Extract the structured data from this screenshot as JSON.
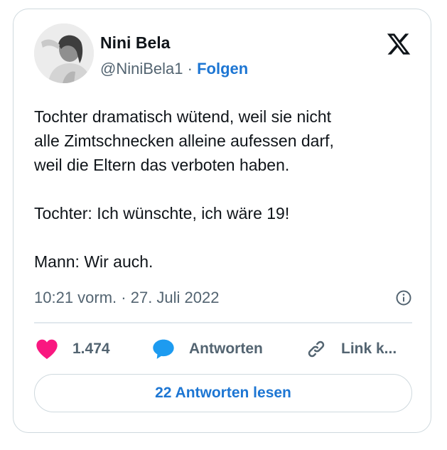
{
  "author": {
    "name": "Nini Bela",
    "handle": "@NiniBela1",
    "separator": "·",
    "follow_label": "Folgen",
    "avatar_icon": "profile-photo"
  },
  "brand_icon": "x-logo-icon",
  "tweet": {
    "lines": [
      "Tochter dramatisch wütend, weil sie nicht",
      "alle Zimtschnecken alleine aufessen darf,",
      "weil die Eltern das verboten haben.",
      "Tochter: Ich wünschte, ich wäre 19!",
      "Mann: Wir auch."
    ],
    "timestamp": "10:21 vorm. · 27. Juli 2022"
  },
  "actions": {
    "like_count": "1.474",
    "reply_label": "Antworten",
    "link_label": "Link k..."
  },
  "read_replies_label": "22 Antworten lesen",
  "colors": {
    "accent": "#1d76d3",
    "like": "#f91880",
    "reply": "#1d9bf0",
    "muted": "#536471",
    "border": "#cfd9de"
  }
}
